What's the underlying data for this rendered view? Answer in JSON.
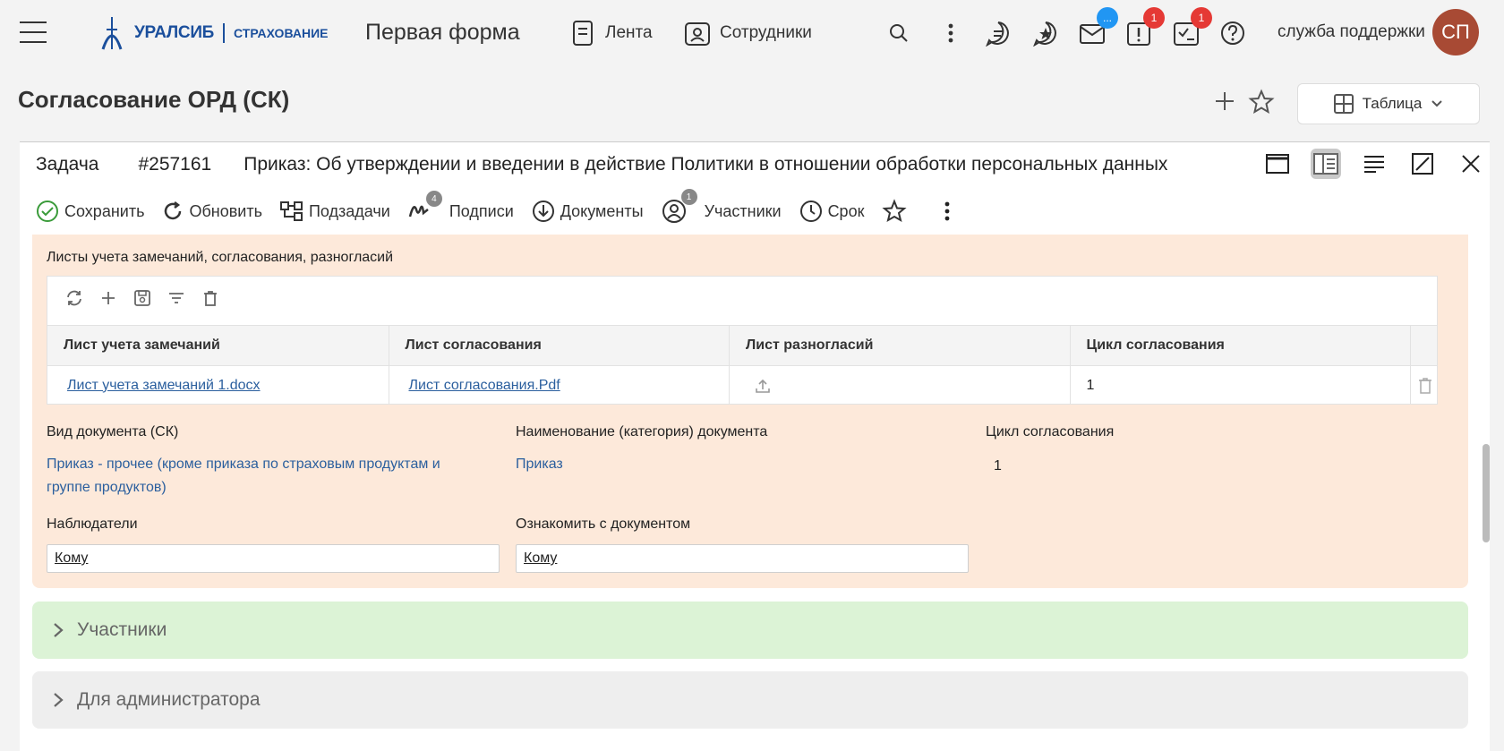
{
  "header": {
    "logo_text": "УРАЛСИБ",
    "logo_sub": "СТРАХОВАНИЕ",
    "app_title": "Первая форма",
    "nav": [
      {
        "label": "Лента",
        "icon": "feed-icon"
      },
      {
        "label": "Сотрудники",
        "icon": "employees-icon"
      }
    ],
    "badges": {
      "messages": "...",
      "tasks": "1",
      "approvals": "1"
    },
    "support_label": "служба поддержки",
    "avatar_initials": "СП"
  },
  "page": {
    "title": "Согласование ОРД (СК)",
    "view_label": "Таблица"
  },
  "task": {
    "kind": "Задача",
    "number": "#257161",
    "name": "Приказ: Об утверждении и введении в действие Политики в отношении обработки персональных данных"
  },
  "toolbar": {
    "save": "Сохранить",
    "refresh": "Обновить",
    "subtasks": "Подзадачи",
    "signatures": "Подписи",
    "signatures_count": "4",
    "documents": "Документы",
    "participants": "Участники",
    "participants_count": "1",
    "deadline": "Срок"
  },
  "sheets": {
    "title": "Листы учета замечаний, согласования, разногласий",
    "columns": [
      "Лист учета замечаний",
      "Лист согласования",
      "Лист разногласий",
      "Цикл согласования"
    ],
    "rows": [
      {
        "remarks": "Лист учета замечаний 1.docx",
        "approval": "Лист согласования.Pdf",
        "cycle": "1"
      }
    ]
  },
  "fields": {
    "doc_type_label": "Вид документа (СК)",
    "doc_type_value": "Приказ - прочее (кроме приказа по страховым продуктам и группе продуктов)",
    "doc_name_label": "Наименование (категория) документа",
    "doc_name_value": "Приказ",
    "cycle_label": "Цикл согласования",
    "cycle_value": "1",
    "observers_label": "Наблюдатели",
    "observers_value": "Кому",
    "acquaint_label": "Ознакомить с документом",
    "acquaint_value": "Кому"
  },
  "sections": {
    "participants": "Участники",
    "admin": "Для администратора"
  },
  "colors": {
    "orange_bg": "#fde9da",
    "green_bg": "#dcf3d6",
    "gray_bg": "#eeeeee",
    "link": "#2b5f9e",
    "badge_blue": "#2196f3",
    "badge_red": "#e53935"
  }
}
